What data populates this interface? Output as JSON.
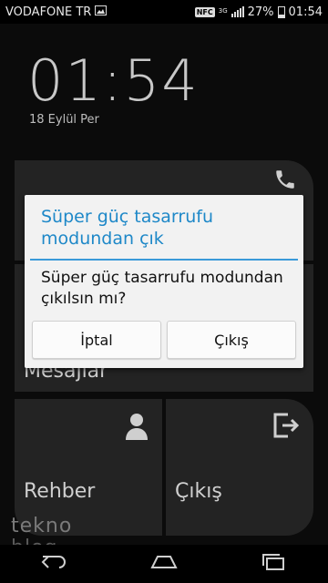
{
  "status_bar": {
    "carrier": "VODAFONE TR",
    "nfc": "NFC",
    "network": "3G",
    "battery_percent": "27%",
    "battery_level": 0.27,
    "time": "01:54"
  },
  "lock": {
    "time": "01:54",
    "date": "18 Eylül Per"
  },
  "tiles": {
    "messages_label": "Mesajlar",
    "contacts_label": "Rehber",
    "exit_label": "Çıkış"
  },
  "dialog": {
    "title": "Süper güç tasarrufu modundan çık",
    "message": "Süper güç tasarrufu modundan çıkılsın mı?",
    "cancel_label": "İptal",
    "exit_label": "Çıkış",
    "accent": "#1e88c8"
  },
  "watermark": {
    "line1": "tekno",
    "line2": "blog"
  },
  "icons": {
    "image": "image-icon",
    "signal": "signal-icon",
    "battery": "battery-icon",
    "phone": "phone-icon",
    "contact": "contact-icon",
    "exit": "exit-icon",
    "back": "back-icon",
    "home": "home-icon",
    "recents": "recents-icon"
  }
}
